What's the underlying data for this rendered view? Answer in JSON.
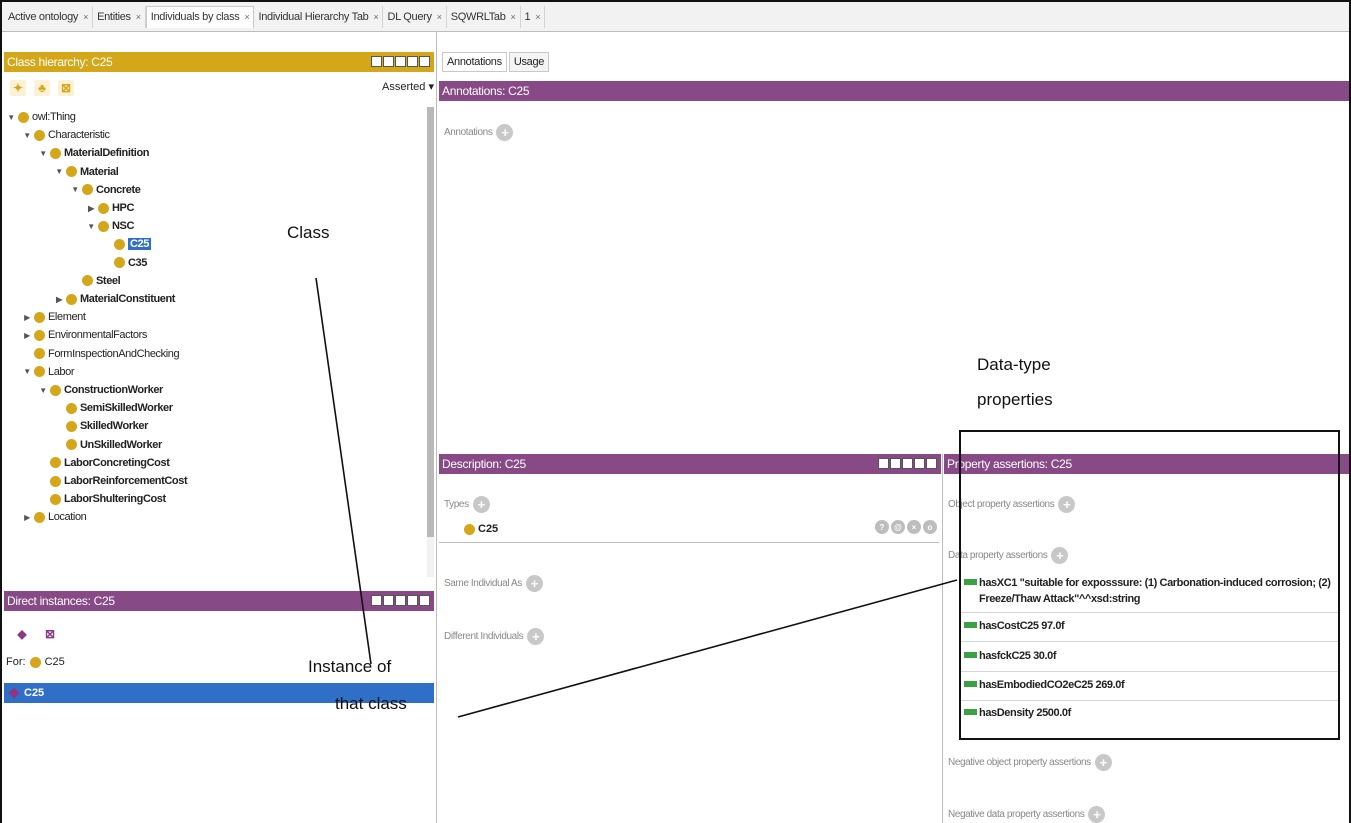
{
  "tabs": [
    {
      "label": "Active ontology",
      "active": false
    },
    {
      "label": "Entities",
      "active": false
    },
    {
      "label": "Individuals by class",
      "active": true
    },
    {
      "label": "Individual Hierarchy Tab",
      "active": false
    },
    {
      "label": "DL Query",
      "active": false
    },
    {
      "label": "SQWRLTab",
      "active": false
    },
    {
      "label": "1",
      "active": false
    }
  ],
  "tab_close": "×",
  "class_hierarchy": {
    "title": "Class hierarchy: C25",
    "mode": "Asserted ▾",
    "tree": [
      {
        "label": "owl:Thing",
        "depth": 0,
        "toggle": "▼",
        "bold": false
      },
      {
        "label": "Characteristic",
        "depth": 1,
        "toggle": "▼",
        "bold": false
      },
      {
        "label": "MaterialDefinition",
        "depth": 2,
        "toggle": "▼",
        "bold": true
      },
      {
        "label": "Material",
        "depth": 3,
        "toggle": "▼",
        "bold": true
      },
      {
        "label": "Concrete",
        "depth": 4,
        "toggle": "▼",
        "bold": true
      },
      {
        "label": "HPC",
        "depth": 5,
        "toggle": "▶",
        "bold": true
      },
      {
        "label": "NSC",
        "depth": 5,
        "toggle": "▼",
        "bold": true
      },
      {
        "label": "C25",
        "depth": 6,
        "toggle": "",
        "bold": true,
        "selected": true
      },
      {
        "label": "C35",
        "depth": 6,
        "toggle": "",
        "bold": true
      },
      {
        "label": "Steel",
        "depth": 4,
        "toggle": "",
        "bold": true
      },
      {
        "label": "MaterialConstituent",
        "depth": 3,
        "toggle": "▶",
        "bold": true
      },
      {
        "label": "Element",
        "depth": 1,
        "toggle": "▶",
        "bold": false
      },
      {
        "label": "EnvironmentalFactors",
        "depth": 1,
        "toggle": "▶",
        "bold": false
      },
      {
        "label": "FormInspectionAndChecking",
        "depth": 1,
        "toggle": "",
        "bold": false
      },
      {
        "label": "Labor",
        "depth": 1,
        "toggle": "▼",
        "bold": false
      },
      {
        "label": "ConstructionWorker",
        "depth": 2,
        "toggle": "▼",
        "bold": true
      },
      {
        "label": "SemiSkilledWorker",
        "depth": 3,
        "toggle": "",
        "bold": true
      },
      {
        "label": "SkilledWorker",
        "depth": 3,
        "toggle": "",
        "bold": true
      },
      {
        "label": "UnSkilledWorker",
        "depth": 3,
        "toggle": "",
        "bold": true
      },
      {
        "label": "LaborConcretingCost",
        "depth": 2,
        "toggle": "",
        "bold": true
      },
      {
        "label": "LaborReinforcementCost",
        "depth": 2,
        "toggle": "",
        "bold": true
      },
      {
        "label": "LaborShulteringCost",
        "depth": 2,
        "toggle": "",
        "bold": true
      },
      {
        "label": "Location",
        "depth": 1,
        "toggle": "▶",
        "bold": false
      }
    ]
  },
  "direct_instances": {
    "title": "Direct instances: C25",
    "for_label": "For:",
    "for_class": "C25",
    "instance": "C25"
  },
  "right_tabs": [
    "Annotations",
    "Usage"
  ],
  "annotations": {
    "title": "Annotations: C25",
    "label": "Annotations"
  },
  "description": {
    "title": "Description: C25",
    "types_label": "Types",
    "type_value": "C25",
    "same_label": "Same Individual As",
    "different_label": "Different Individuals"
  },
  "property_assertions": {
    "title": "Property assertions: C25",
    "object_label": "Object property assertions",
    "data_label": "Data property assertions",
    "data_props": [
      "hasXC1  \"suitable for exposssure: (1) Carbonation-induced corrosion; (2) Freeze/Thaw Attack\"^^xsd:string",
      "hasCostC25  97.0f",
      "hasfckC25  30.0f",
      "hasEmbodiedCO2eC25  269.0f",
      "hasDensity  2500.0f"
    ],
    "neg_object_label": "Negative object property assertions",
    "neg_data_label": "Negative data property assertions"
  },
  "overlay": {
    "class_label": "Class",
    "instance_label_1": "Instance of",
    "instance_label_2": "that class",
    "datatype_label_1": "Data-type",
    "datatype_label_2": "properties"
  },
  "colors": {
    "gold_header": "#d4a61a",
    "purple_header": "#874a86",
    "selection": "#2f6fc8",
    "data_prop": "#3aa145"
  }
}
